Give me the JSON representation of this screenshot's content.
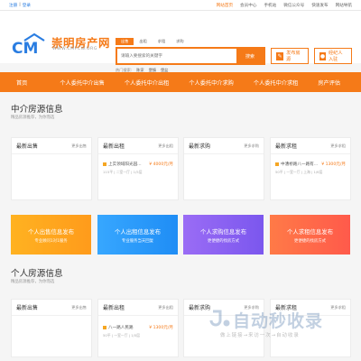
{
  "topbar": {
    "login": "注册",
    "sep": "|",
    "register": "登录",
    "links": [
      "网站首页",
      "会员中心",
      "手机站",
      "微信公众号",
      "快速发布",
      "网站导航"
    ]
  },
  "logo": {
    "mark": "CM",
    "title": "崇明房产网",
    "url": "WWW.CMFCW.ORG"
  },
  "search": {
    "tabs": [
      "出售",
      "出租",
      "求租",
      "求购"
    ],
    "placeholder": "请输入要搜索的关键字",
    "button": "搜索",
    "hot_label": "热门搜索:",
    "hot_words": [
      "陈家",
      "堡镇",
      "堡盆"
    ]
  },
  "header_buttons": {
    "publish": "发布房源",
    "agent": "经纪人入驻"
  },
  "nav": [
    "首页",
    "个人委托中介出售",
    "个人委托中介出租",
    "个人委托中介求购",
    "个人委托中介求租",
    "房产评估"
  ],
  "agency_section": {
    "title": "中介房源信息",
    "subtitle": "精品房源推荐，为你而选"
  },
  "agency_cards": [
    {
      "title": "最新出售",
      "more": "更多出售",
      "items": []
    },
    {
      "title": "最新出租",
      "more": "更多出租",
      "items": [
        {
          "name": "上实领域阳光园...",
          "price": "¥ 4000元/月",
          "meta": "115平 | 二室一厅 | 1/5层"
        }
      ]
    },
    {
      "title": "最新求购",
      "more": "更多求购",
      "items": []
    },
    {
      "title": "最新求租",
      "more": "更多求租",
      "items": [
        {
          "name": "中漕桥路八一路有...",
          "price": "¥ 1300元/月",
          "meta": "50平 | 一室一厅 | 上海 | 1/6层"
        }
      ]
    }
  ],
  "promos": [
    {
      "title": "个人出售信息发布",
      "sub": "专业顾问1对1服务"
    },
    {
      "title": "个人出租信息发布",
      "sub": "专业服务当天回复"
    },
    {
      "title": "个人求购信息发布",
      "sub": "更便捷的找房方式"
    },
    {
      "title": "个人求租信息发布",
      "sub": "更便捷的找房方式"
    }
  ],
  "personal_section": {
    "title": "个人房源信息",
    "subtitle": "精品房源推荐，为你而选"
  },
  "personal_cards": [
    {
      "title": "最新出售",
      "more": "更多出售",
      "items": []
    },
    {
      "title": "最新出租",
      "more": "更多出租",
      "items": [
        {
          "name": "八一路人民路",
          "price": "¥ 1300元/月",
          "meta": "50平 | 一室一厅 | 1/5层"
        }
      ]
    },
    {
      "title": "最新求购",
      "more": "更多求购",
      "items": []
    },
    {
      "title": "最新求租",
      "more": "更多求租",
      "items": []
    }
  ],
  "watermark": {
    "title": "自动秒收录",
    "sub": "做上链接→来访一次→自动收录"
  },
  "colors": {
    "accent": "#f57a18",
    "link": "#2a7de1"
  }
}
